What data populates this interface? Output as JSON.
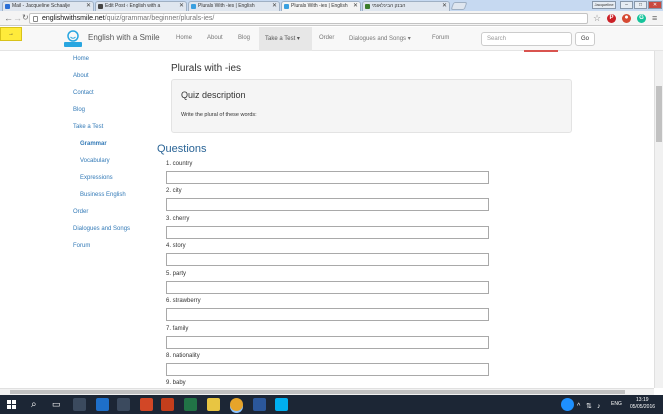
{
  "browser": {
    "tabs": [
      {
        "title": "Mail - Jacqueline Schaalje",
        "color": "#2b6fd6"
      },
      {
        "title": "Edit Post ‹ English with a",
        "color": "#464646"
      },
      {
        "title": "Plurals With -ies | English",
        "color": "#3aa0e0"
      },
      {
        "title": "Plurals With -ies | English",
        "color": "#3aa0e0"
      },
      {
        "title": "הבנק הבינלאומי",
        "color": "#3b7d2c"
      }
    ],
    "profile_label": "Jacqueline",
    "window_controls": [
      "–",
      "□",
      "✕"
    ],
    "url_host": "englishwithsmile.net",
    "url_path": "/quiz/grammar/beginner/plurals-ies/"
  },
  "header": {
    "bookmark_arrow": "→",
    "logo_text": "English with a Smile",
    "nav": [
      "Home",
      "About",
      "Blog",
      "Take a Test ▾",
      "Order",
      "Dialogues and Songs ▾",
      "Forum"
    ],
    "search_placeholder": "Search",
    "go_label": "Go"
  },
  "sidebar": [
    "Home",
    "About",
    "Contact",
    "Blog",
    "Take a Test",
    "Grammar",
    "Vocabulary",
    "Expressions",
    "Business English",
    "Order",
    "Dialogues and Songs",
    "Forum"
  ],
  "main": {
    "page_title": "Plurals with -ies",
    "quiz_heading": "Quiz description",
    "quiz_instructions": "Write the plural of these words:",
    "questions_heading": "Questions",
    "questions": [
      "1. country",
      "2. city",
      "3. cherry",
      "4. story",
      "5. party",
      "6. strawberry",
      "7. family",
      "8. nationality",
      "9. baby"
    ]
  },
  "taskbar": {
    "lang": "ENG",
    "time": "13:19",
    "date": "05/05/2016"
  }
}
